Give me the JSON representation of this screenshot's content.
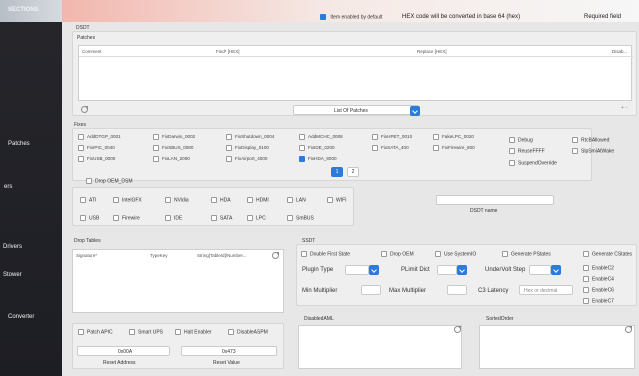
{
  "sidebar": {
    "title": "SECTIONS",
    "items": [
      "Patches",
      "ers",
      "Drivers",
      "Stower",
      "Converter"
    ]
  },
  "top": {
    "checkbox_label": "Item enabled by default",
    "hex_note": "HEX code will be converted in base 64 (hex)",
    "required": "Required field"
  },
  "dsdt": {
    "label": "DSDT",
    "patches_label": "Patches",
    "columns": [
      "Comment",
      "Find* [HEX]",
      "Replace [HEX]",
      "Disab..."
    ],
    "list_label": "List Of Patches"
  },
  "fixes": {
    "label": "Fixes",
    "items": [
      "AddDTGP_0001",
      "FixDarwin_0002",
      "FixShutdown_0004",
      "AddMCHC_0008",
      "FixHPET_0010",
      "FakeLPC_0020",
      "FixIPIC_0040",
      "FixSBUS_0080",
      "FixDisplay_0100",
      "FixIDE_0200",
      "FixSATA_400",
      "FixFirewire_800",
      "FixUSB_0000",
      "FixLAN_2000",
      "FixAirport_4000",
      "FixHDA_8000"
    ],
    "page_buttons": [
      "1",
      "2"
    ],
    "drop_oem": "Drop OEM_DSM"
  },
  "devices": [
    "ATI",
    "IntelGFX",
    "NVidia",
    "HDA",
    "HDMI",
    "LAN",
    "WIFI",
    "USB",
    "Firewire",
    "IDE",
    "SATA",
    "LPC",
    "SmBUS"
  ],
  "right_options": [
    "Debug",
    "ReuseFFFF",
    "SuspendOverride",
    "RtcBAllowed",
    "SlpSmiAtWake"
  ],
  "dsdt_name_label": "DSDT name",
  "drop_tables": {
    "label": "Drop Tables",
    "columns": [
      "Signature*",
      "TypeKey",
      "String[TableId]/Number..."
    ]
  },
  "ssdt": {
    "label": "SSDT",
    "checkboxes": [
      "Double First State",
      "Drop OEM",
      "Use SystemIO",
      "Generate PStates",
      "Generate CStates"
    ],
    "plugin_type_label": "Plugin Type",
    "plimit_dict_label": "PLimit Dict",
    "undervolt_label": "UnderVolt Step",
    "min_multiplier_label": "Min Multiplier",
    "max_multiplier_label": "Max Multiplier",
    "c3_latency_label": "C3 Latency",
    "c3_latency_placeholder": "Hex or decimal",
    "right_checks": [
      "EnableC2",
      "EnableC4",
      "EnableC6",
      "EnableC7"
    ]
  },
  "bottom_left": {
    "checks": [
      "Patch APIC",
      "Smart UPS",
      "Halt Enabler",
      "DisableASPM"
    ],
    "input1": "0x00A",
    "input2": "0x473",
    "reset_address": "Reset Address",
    "reset_value": "Reset Value"
  },
  "disabled_aml": "DisabledAML",
  "sorted_order": "SortedOrder"
}
